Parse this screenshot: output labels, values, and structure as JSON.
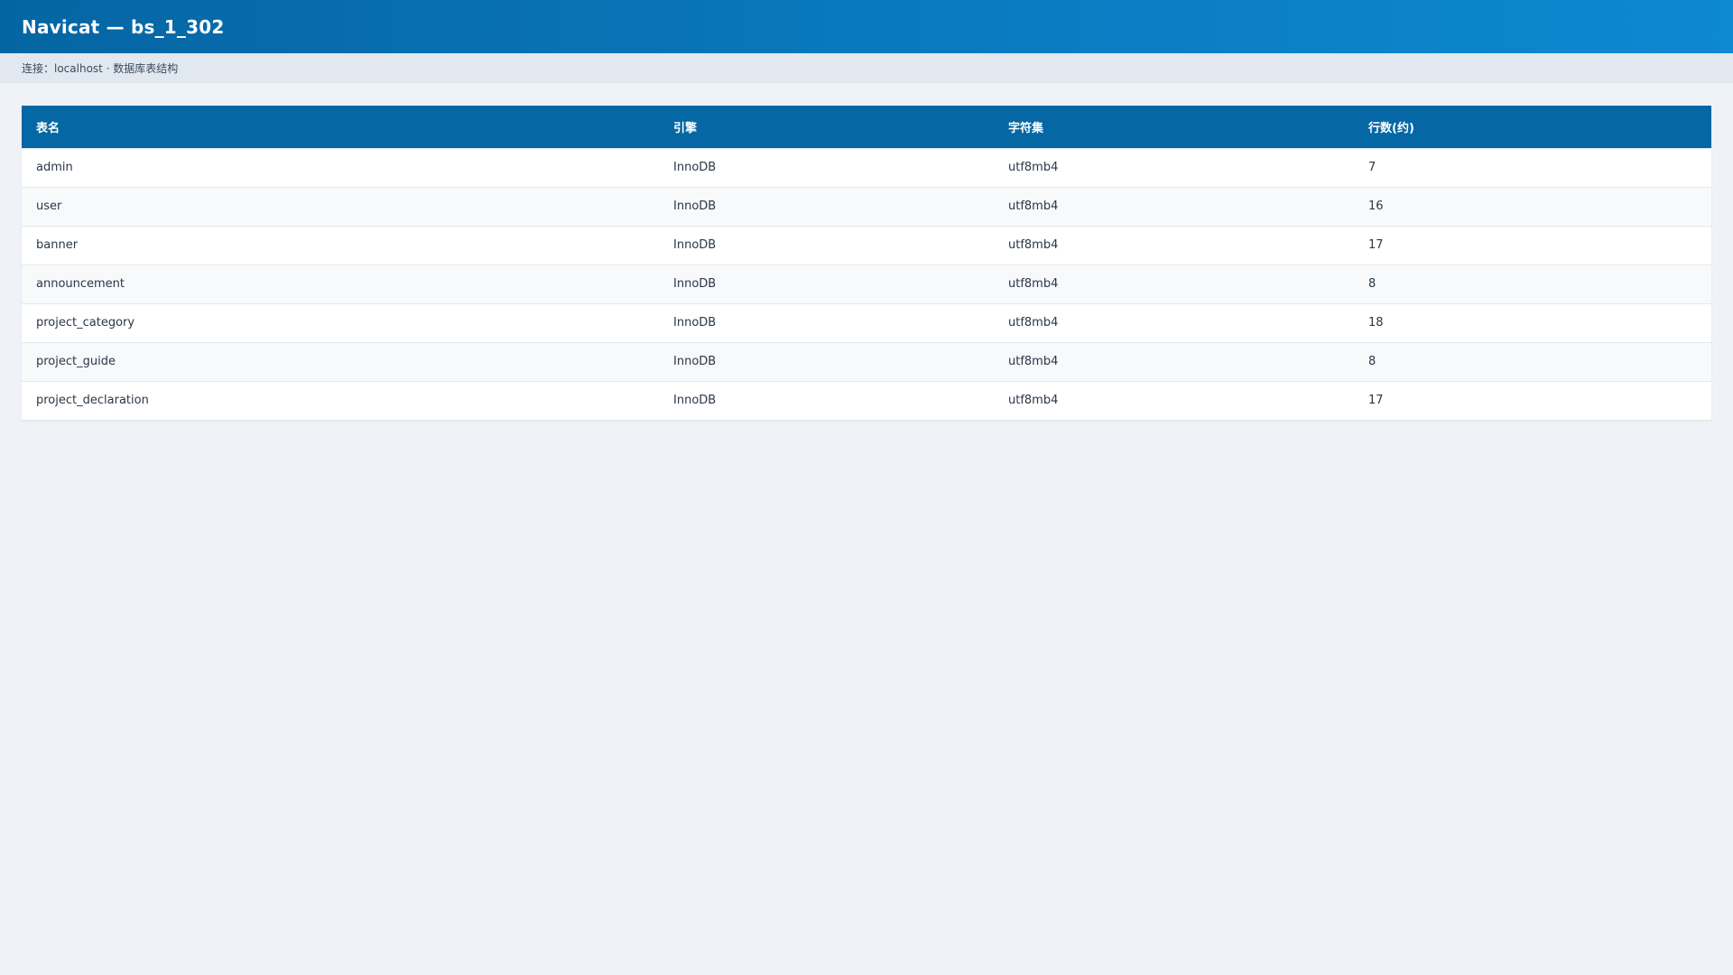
{
  "window": {
    "title": "Navicat — bs_1_302"
  },
  "subbar": {
    "text": "连接：localhost · 数据库表结构"
  },
  "table": {
    "columns": [
      "表名",
      "引擎",
      "字符集",
      "行数(约)"
    ],
    "rows": [
      {
        "name": "admin",
        "engine": "InnoDB",
        "charset": "utf8mb4",
        "rows": "7"
      },
      {
        "name": "user",
        "engine": "InnoDB",
        "charset": "utf8mb4",
        "rows": "16"
      },
      {
        "name": "banner",
        "engine": "InnoDB",
        "charset": "utf8mb4",
        "rows": "17"
      },
      {
        "name": "announcement",
        "engine": "InnoDB",
        "charset": "utf8mb4",
        "rows": "8"
      },
      {
        "name": "project_category",
        "engine": "InnoDB",
        "charset": "utf8mb4",
        "rows": "18"
      },
      {
        "name": "project_guide",
        "engine": "InnoDB",
        "charset": "utf8mb4",
        "rows": "8"
      },
      {
        "name": "project_declaration",
        "engine": "InnoDB",
        "charset": "utf8mb4",
        "rows": "17"
      }
    ]
  },
  "colors": {
    "titlebar_start": "#0565a3",
    "titlebar_end": "#0d89d1",
    "header_bg": "#0567a3",
    "page_bg": "#eff3f8"
  }
}
